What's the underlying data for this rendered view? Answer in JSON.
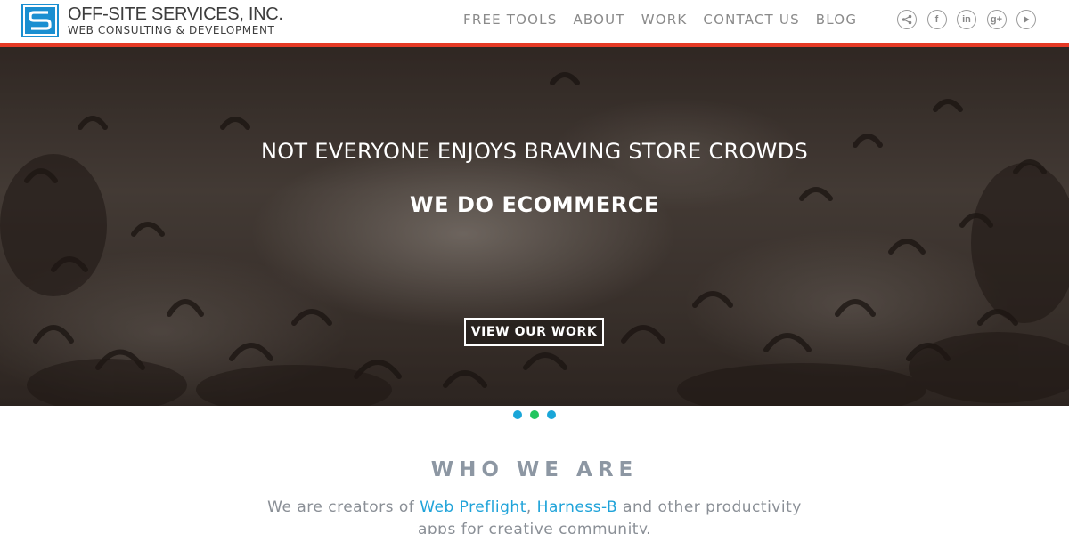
{
  "header": {
    "logo": {
      "name": "OFF-SITE SERVICES, INC.",
      "tagline": "WEB CONSULTING & DEVELOPMENT",
      "mark_letter": "S",
      "mark_color": "#1a8fd1"
    },
    "accent_bar_color": "#e53a25",
    "nav": [
      "FREE TOOLS",
      "ABOUT",
      "WORK",
      "CONTACT US",
      "BLOG"
    ],
    "social": [
      {
        "icon": "share-icon",
        "glyph": ""
      },
      {
        "icon": "facebook-icon",
        "glyph": "f"
      },
      {
        "icon": "linkedin-icon",
        "glyph": "in"
      },
      {
        "icon": "google-plus-icon",
        "glyph": "g+"
      },
      {
        "icon": "youtube-play-icon",
        "glyph": ""
      }
    ]
  },
  "hero": {
    "headline": "NOT EVERYONE ENJOYS BRAVING STORE CROWDS",
    "subheadline": "WE DO ECOMMERCE",
    "cta_label": "VIEW OUR WORK"
  },
  "carousel": {
    "dot_colors": [
      "#1aa6d8",
      "#22c55e",
      "#1aa6d8"
    ],
    "active_index": 1
  },
  "who": {
    "title": "WHO WE ARE",
    "text_before": "We are creators of ",
    "link1": "Web Preflight",
    "sep": ", ",
    "link2": "Harness-B",
    "text_after": " and other productivity apps for creative community."
  }
}
